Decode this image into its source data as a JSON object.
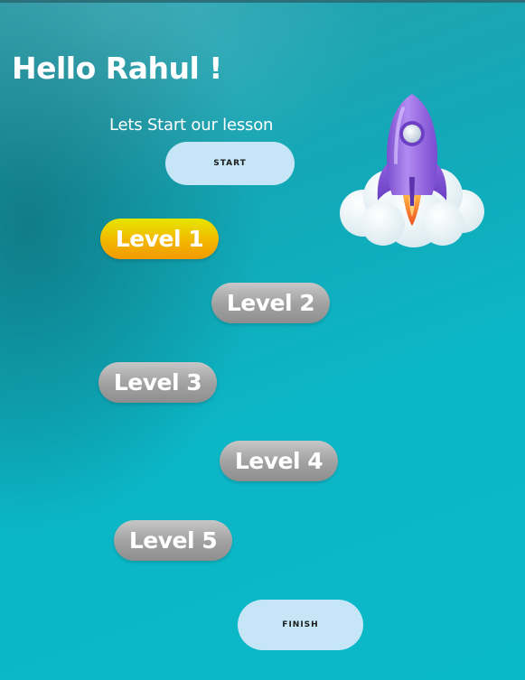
{
  "greeting": "Hello Rahul !",
  "subtitle": "Lets Start our lesson",
  "buttons": {
    "start_label": "START",
    "finish_label": "FINISH"
  },
  "levels": [
    {
      "label": "Level 1",
      "state": "active"
    },
    {
      "label": "Level 2",
      "state": "locked"
    },
    {
      "label": "Level 3",
      "state": "locked"
    },
    {
      "label": "Level 4",
      "state": "locked"
    },
    {
      "label": "Level 5",
      "state": "locked"
    }
  ],
  "illustration": {
    "icon": "rocket-cloud-icon"
  },
  "colors": {
    "background": "#0ab9c8",
    "button_bg": "#c6e6f7",
    "active_level_top": "#e6e600",
    "active_level_bottom": "#f39a00",
    "locked_level": "#a3a3a3",
    "rocket_body": "#9a6be0",
    "flame": "#f26b2a"
  }
}
